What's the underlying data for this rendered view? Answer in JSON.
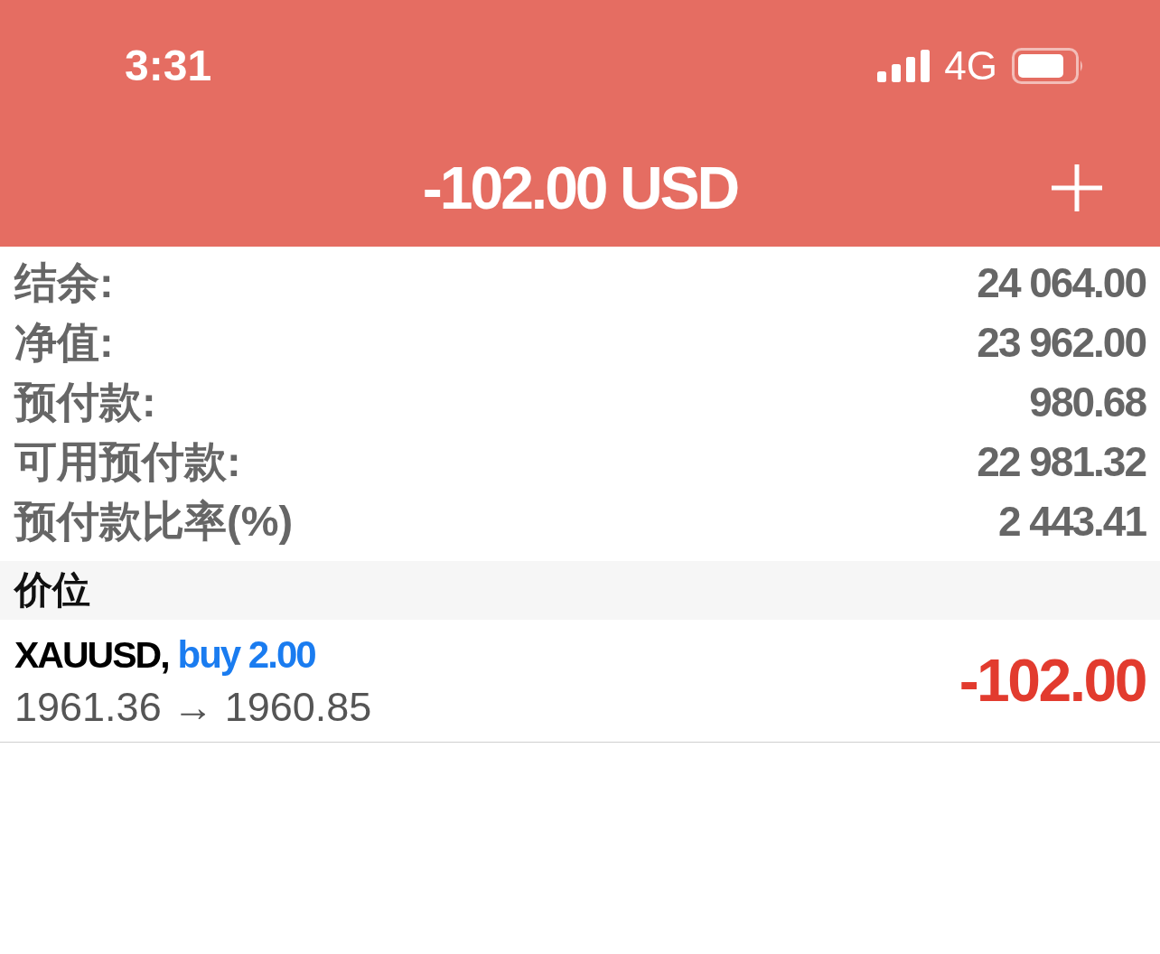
{
  "status_bar": {
    "time": "3:31",
    "network": "4G"
  },
  "header": {
    "title": "-102.00 USD"
  },
  "summary": [
    {
      "label": "结余:",
      "value": "24 064.00"
    },
    {
      "label": "净值:",
      "value": "23 962.00"
    },
    {
      "label": "预付款:",
      "value": "980.68"
    },
    {
      "label": "可用预付款:",
      "value": "22 981.32"
    },
    {
      "label": "预付款比率(%)",
      "value": "2 443.41"
    }
  ],
  "section": {
    "title": "价位"
  },
  "positions": [
    {
      "symbol": "XAUUSD,",
      "side": "buy 2.00",
      "prices": "1961.36 → 1960.85",
      "profit": "-102.00"
    }
  ]
}
